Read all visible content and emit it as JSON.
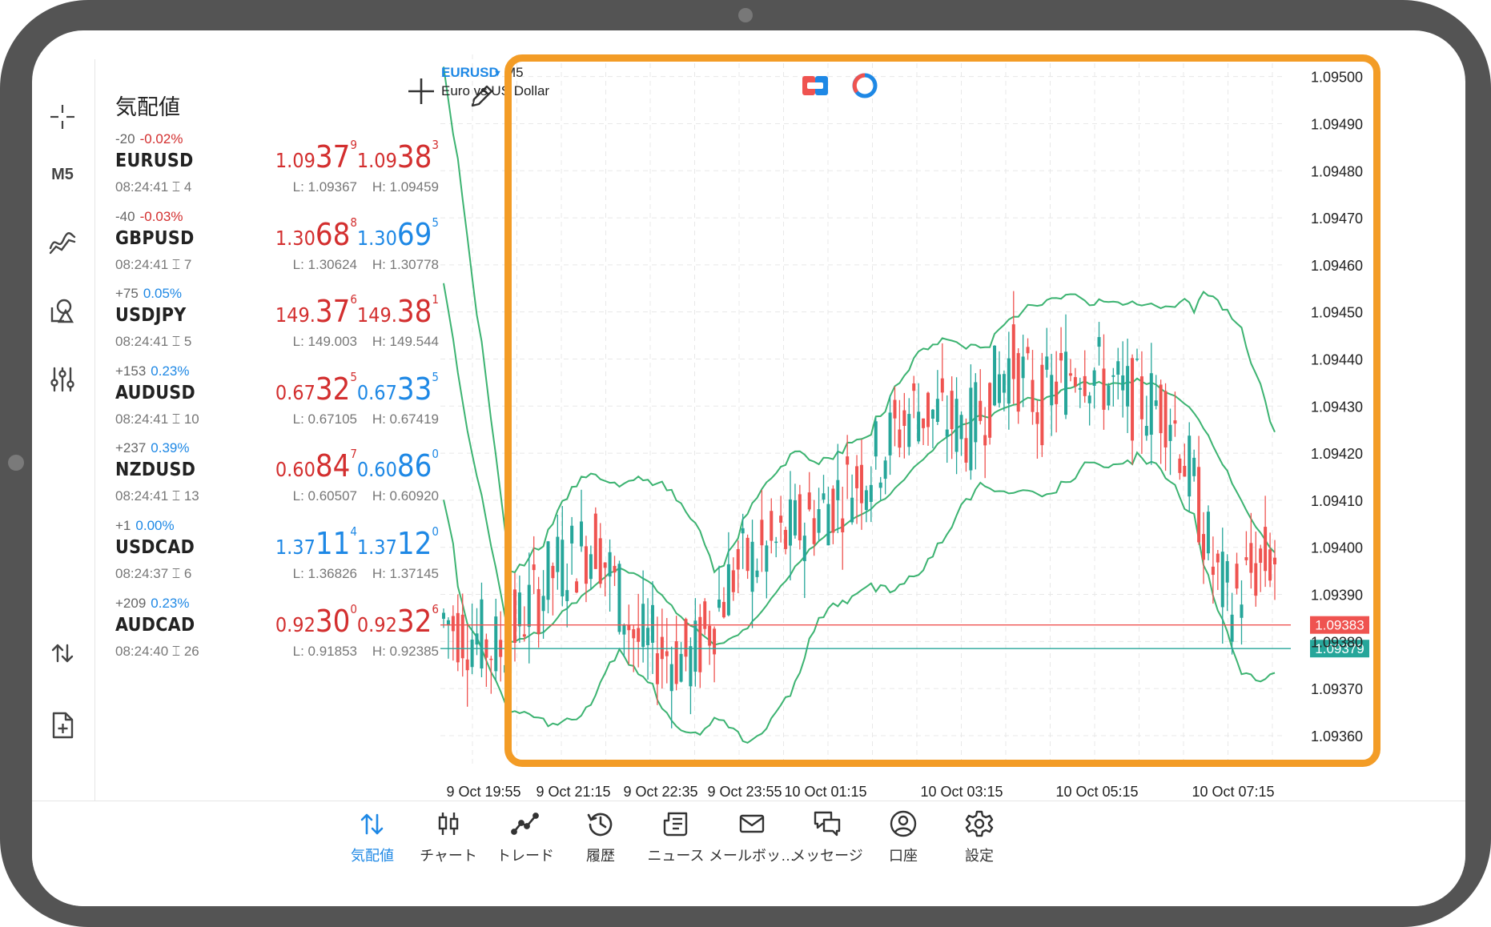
{
  "toolbar": {
    "timeframe": "M5"
  },
  "quotes": {
    "title": "気配値",
    "items": [
      {
        "change": "-20",
        "pct": "-0.02%",
        "dir": "neg",
        "symbol": "EURUSD",
        "time": "08:24:41",
        "spread": "4",
        "bid_small": "1.09",
        "bid_big": "37",
        "bid_sup": "9",
        "bid_color": "red",
        "ask_small": "1.09",
        "ask_big": "38",
        "ask_sup": "3",
        "ask_color": "red",
        "low": "L: 1.09367",
        "high": "H: 1.09459"
      },
      {
        "change": "-40",
        "pct": "-0.03%",
        "dir": "neg",
        "symbol": "GBPUSD",
        "time": "08:24:41",
        "spread": "7",
        "bid_small": "1.30",
        "bid_big": "68",
        "bid_sup": "8",
        "bid_color": "red",
        "ask_small": "1.30",
        "ask_big": "69",
        "ask_sup": "5",
        "ask_color": "blue",
        "low": "L: 1.30624",
        "high": "H: 1.30778"
      },
      {
        "change": "+75",
        "pct": "0.05%",
        "dir": "pos",
        "symbol": "USDJPY",
        "time": "08:24:41",
        "spread": "5",
        "bid_small": "149.",
        "bid_big": "37",
        "bid_sup": "6",
        "bid_color": "red",
        "ask_small": "149.",
        "ask_big": "38",
        "ask_sup": "1",
        "ask_color": "red",
        "low": "L: 149.003",
        "high": "H: 149.544"
      },
      {
        "change": "+153",
        "pct": "0.23%",
        "dir": "pos",
        "symbol": "AUDUSD",
        "time": "08:24:41",
        "spread": "10",
        "bid_small": "0.67",
        "bid_big": "32",
        "bid_sup": "5",
        "bid_color": "red",
        "ask_small": "0.67",
        "ask_big": "33",
        "ask_sup": "5",
        "ask_color": "blue",
        "low": "L: 0.67105",
        "high": "H: 0.67419"
      },
      {
        "change": "+237",
        "pct": "0.39%",
        "dir": "pos",
        "symbol": "NZDUSD",
        "time": "08:24:41",
        "spread": "13",
        "bid_small": "0.60",
        "bid_big": "84",
        "bid_sup": "7",
        "bid_color": "red",
        "ask_small": "0.60",
        "ask_big": "86",
        "ask_sup": "0",
        "ask_color": "blue",
        "low": "L: 0.60507",
        "high": "H: 0.60920"
      },
      {
        "change": "+1",
        "pct": "0.00%",
        "dir": "pos",
        "symbol": "USDCAD",
        "time": "08:24:37",
        "spread": "6",
        "bid_small": "1.37",
        "bid_big": "11",
        "bid_sup": "4",
        "bid_color": "blue",
        "ask_small": "1.37",
        "ask_big": "12",
        "ask_sup": "0",
        "ask_color": "blue",
        "low": "L: 1.36826",
        "high": "H: 1.37145"
      },
      {
        "change": "+209",
        "pct": "0.23%",
        "dir": "pos",
        "symbol": "AUDCAD",
        "time": "08:24:40",
        "spread": "26",
        "bid_small": "0.92",
        "bid_big": "30",
        "bid_sup": "0",
        "bid_color": "red",
        "ask_small": "0.92",
        "ask_big": "32",
        "ask_sup": "6",
        "ask_color": "red",
        "low": "L: 0.91853",
        "high": "H: 0.92385"
      }
    ]
  },
  "chart": {
    "symbol": "EURUSD",
    "timeframe": "M5",
    "description": "Euro vs US Dollar",
    "highlight_color": "#f39c26",
    "up_color": "#26a69a",
    "down_color": "#ef5350",
    "band_color": "#3cb371",
    "bid_line": {
      "value": 1.09383,
      "label": "1.09383",
      "color": "#ef5350"
    },
    "ask_line": {
      "value": 1.09379,
      "label": "1.09379",
      "color": "#26a69a"
    },
    "y_ticks": [
      "1.09500",
      "1.09490",
      "1.09480",
      "1.09470",
      "1.09460",
      "1.09450",
      "1.09440",
      "1.09430",
      "1.09420",
      "1.09410",
      "1.09400",
      "1.09390",
      "1.09380",
      "1.09370",
      "1.09360"
    ],
    "ylim": [
      1.093537,
      1.095047
    ],
    "x_ticks": [
      "9 Oct 19:55",
      "9 Oct 21:15",
      "9 Oct 22:35",
      "9 Oct 23:55",
      "10 Oct 01:15",
      "10 Oct 03:15",
      "10 Oct 05:15",
      "10 Oct 07:15"
    ]
  },
  "nav": [
    {
      "label": "気配値",
      "icon": "quotes-icon",
      "active": true
    },
    {
      "label": "チャート",
      "icon": "candles-icon",
      "active": false
    },
    {
      "label": "トレード",
      "icon": "trade-icon",
      "active": false
    },
    {
      "label": "履歴",
      "icon": "history-icon",
      "active": false
    },
    {
      "label": "ニュース",
      "icon": "news-icon",
      "active": false
    },
    {
      "label": "メールボッ…",
      "icon": "mail-icon",
      "active": false
    },
    {
      "label": "メッセージ",
      "icon": "messages-icon",
      "active": false
    },
    {
      "label": "口座",
      "icon": "account-icon",
      "active": false
    },
    {
      "label": "設定",
      "icon": "settings-icon",
      "active": false
    }
  ]
}
